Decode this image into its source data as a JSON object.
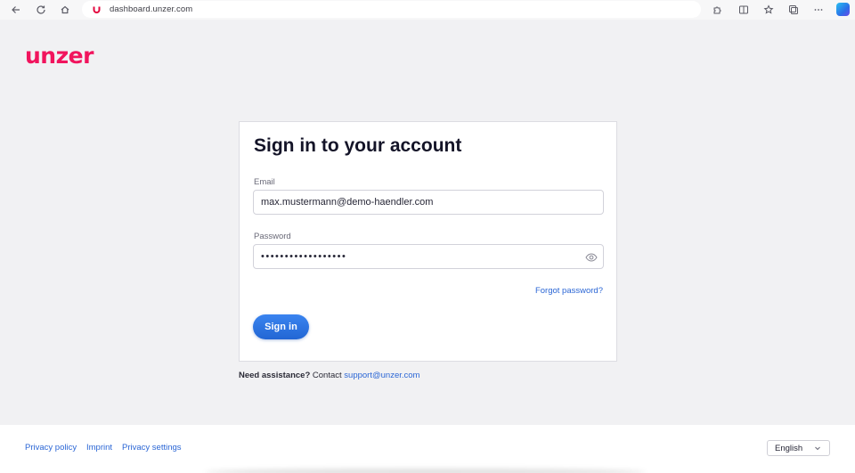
{
  "browser": {
    "url": "dashboard.unzer.com"
  },
  "logo": {
    "text": "unzer",
    "brand_color": "#f1145d"
  },
  "login": {
    "title": "Sign in to your account",
    "email_label": "Email",
    "email_value": "max.mustermann@demo-haendler.com",
    "password_label": "Password",
    "password_value": "••••••••••••••••••",
    "forgot_label": "Forgot password?",
    "signin_label": "Sign in",
    "accent_color": "#2b6fe0"
  },
  "assistance": {
    "prefix": "Need assistance?",
    "middle": "Contact",
    "email": "support@unzer.com"
  },
  "footer": {
    "links": [
      "Privacy policy",
      "Imprint",
      "Privacy settings"
    ],
    "language": "English"
  }
}
